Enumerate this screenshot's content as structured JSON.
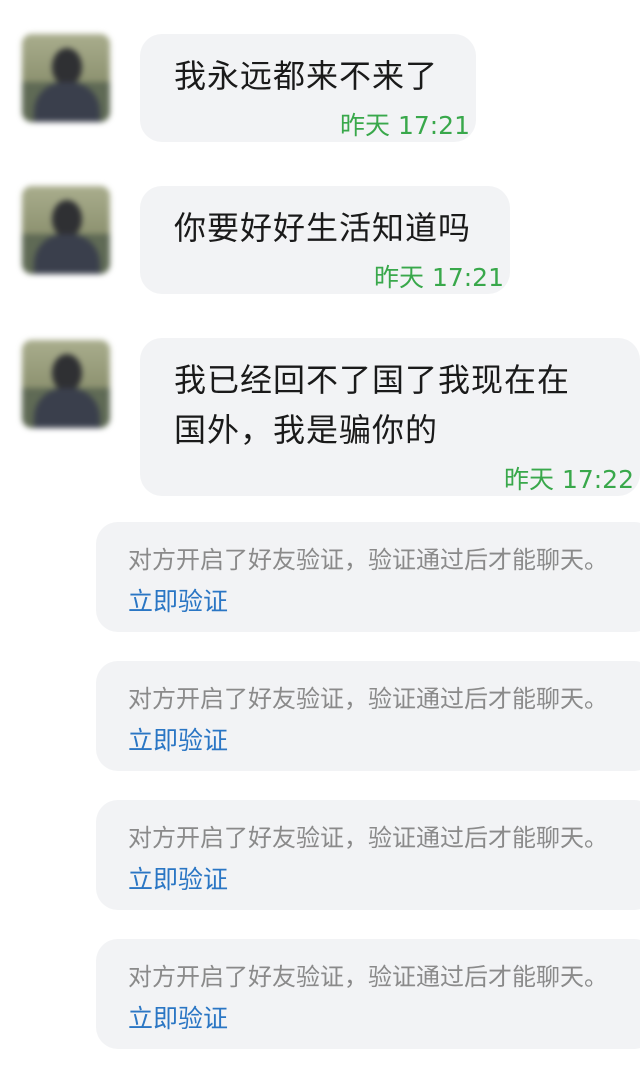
{
  "messages": [
    {
      "text": "我永远都来不来了",
      "time": "昨天 17:21"
    },
    {
      "text": "你要好好生活知道吗",
      "time": "昨天 17:21"
    },
    {
      "text_line1": "我已经回不了国了我现在在",
      "text_line2": "国外，我是骗你的",
      "time": "昨天 17:22"
    }
  ],
  "notices": [
    {
      "text": "对方开启了好友验证，验证通过后才能聊天。",
      "link": "立即验证"
    },
    {
      "text": "对方开启了好友验证，验证通过后才能聊天。",
      "link": "立即验证"
    },
    {
      "text": "对方开启了好友验证，验证通过后才能聊天。",
      "link": "立即验证"
    },
    {
      "text": "对方开启了好友验证，验证通过后才能聊天。",
      "link": "立即验证"
    }
  ],
  "colors": {
    "bubble_bg": "#f2f3f5",
    "time_text": "#39a84b",
    "notice_text": "#8a8a8a",
    "link_text": "#2a76c4"
  }
}
